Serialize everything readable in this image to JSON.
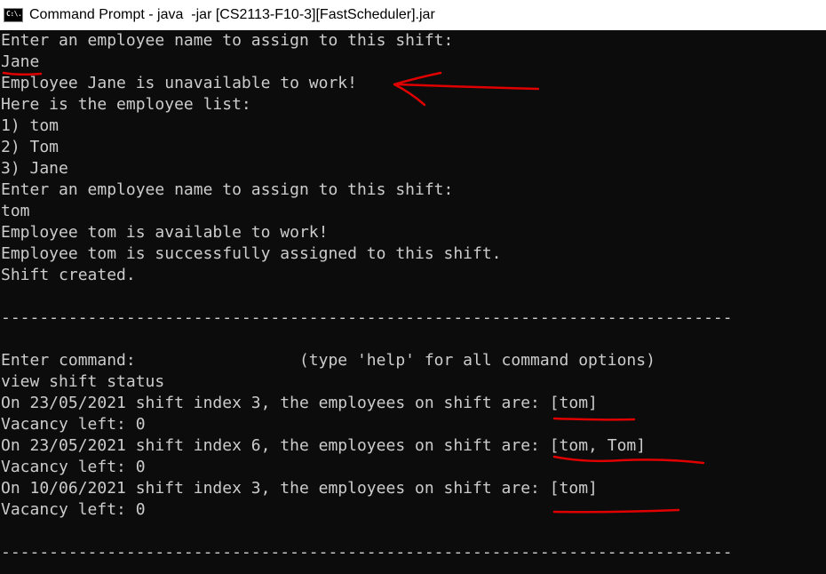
{
  "window": {
    "title": "Command Prompt - java  -jar [CS2113-F10-3][FastScheduler].jar",
    "icon": "cmd-icon",
    "icon_text": "C:\\."
  },
  "console": {
    "lines": [
      "Enter an employee name to assign to this shift:",
      "Jane",
      "Employee Jane is unavailable to work!",
      "Here is the employee list:",
      "1) tom",
      "2) Tom",
      "3) Jane",
      "Enter an employee name to assign to this shift:",
      "tom",
      "Employee tom is available to work!",
      "Employee tom is successfully assigned to this shift.",
      "Shift created.",
      "",
      "----------------------------------------------------------------------------",
      "",
      "Enter command:                 (type 'help' for all command options)",
      "view shift status",
      "On 23/05/2021 shift index 3, the employees on shift are: [tom]",
      "Vacancy left: 0",
      "On 23/05/2021 shift index 6, the employees on shift are: [tom, Tom]",
      "Vacancy left: 0",
      "On 10/06/2021 shift index 3, the employees on shift are: [tom]",
      "Vacancy left: 0",
      "",
      "----------------------------------------------------------------------------"
    ]
  },
  "colors": {
    "console_background": "#0c0c0c",
    "console_text": "#cccccc",
    "annotation": "#e00000"
  }
}
